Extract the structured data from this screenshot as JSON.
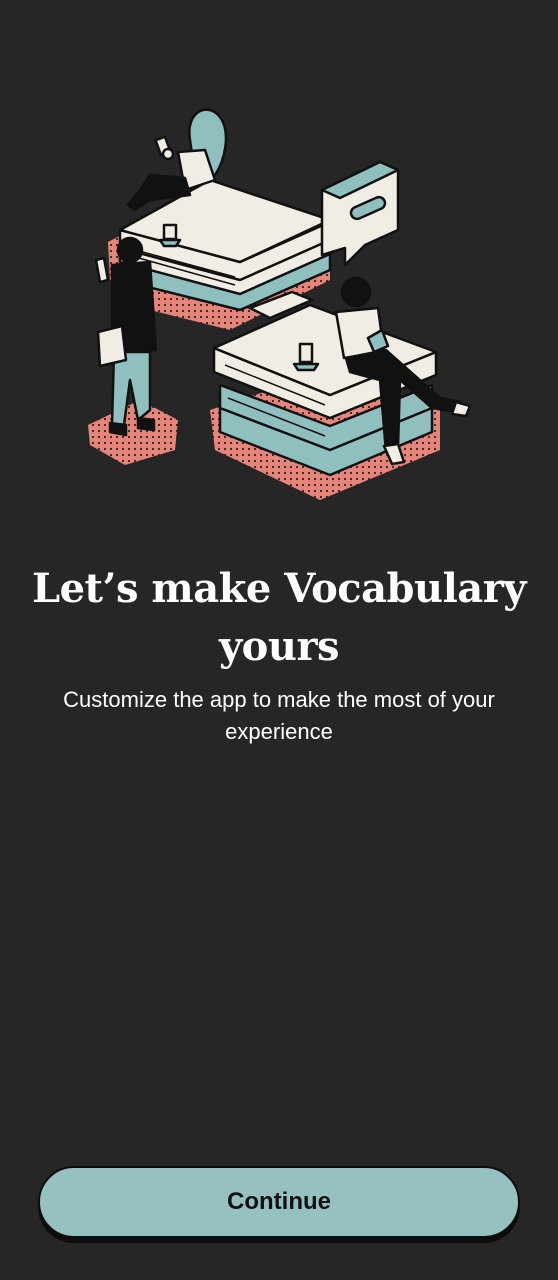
{
  "onboarding": {
    "illustration_icon": "people-reading-on-books-illustration",
    "title": "Let’s make Vocabulary yours",
    "subtitle": "Customize the app to make the most of your experience",
    "continue_label": "Continue"
  },
  "colors": {
    "background": "#262626",
    "button_fill": "#96c1c1",
    "accent_coral": "#e8857a",
    "accent_teal": "#8fbfbf",
    "paper": "#f1ede4",
    "ink": "#111111"
  }
}
